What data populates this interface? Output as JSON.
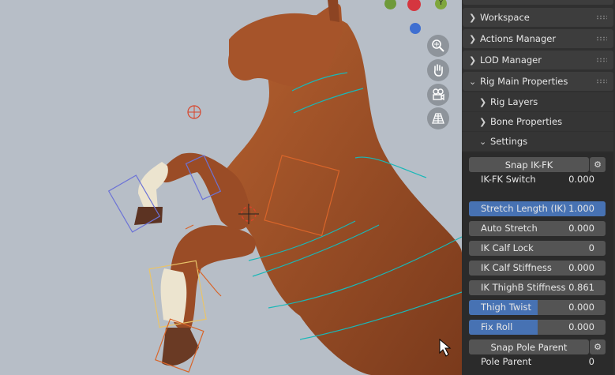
{
  "panel": {
    "sections": [
      {
        "label": "Workspace",
        "chevron": "right"
      },
      {
        "label": "Actions Manager",
        "chevron": "right"
      },
      {
        "label": "LOD Manager",
        "chevron": "right"
      },
      {
        "label": "Rig Main Properties",
        "chevron": "down"
      }
    ],
    "subsections": [
      {
        "label": "Rig Layers",
        "chevron": "right"
      },
      {
        "label": "Bone Properties",
        "chevron": "right"
      },
      {
        "label": "Settings",
        "chevron": "down"
      }
    ],
    "snap_ikfk": "Snap IK-FK",
    "ikfk_switch": {
      "label": "IK-FK Switch",
      "value": "0.000"
    },
    "stretch_length": {
      "label": "Stretch Length (IK)",
      "value": "1.000",
      "fill": 1.0
    },
    "auto_stretch": {
      "label": "Auto Stretch",
      "value": "0.000"
    },
    "ik_calf_lock": {
      "label": "IK Calf Lock",
      "value": "0"
    },
    "ik_calf_stiffness": {
      "label": "IK Calf Stiffness",
      "value": "0.000"
    },
    "ik_thighb_stiffness": {
      "label": "IK ThighB Stiffness",
      "value": "0.861"
    },
    "thigh_twist": {
      "label": "Thigh Twist",
      "value": "0.000",
      "fill": 0.5
    },
    "fix_roll": {
      "label": "Fix Roll",
      "value": "0.000",
      "fill": 0.5
    },
    "snap_pole_parent": "Snap Pole Parent",
    "pole_parent": {
      "label": "Pole Parent",
      "value": "0"
    }
  },
  "viewport": {
    "nav_icons": [
      "zoom-icon",
      "pan-hand-icon",
      "camera-icon",
      "grid-perspective-icon"
    ],
    "gizmo_labels": {
      "y": "Y"
    },
    "colors": {
      "background": "#b7bec7",
      "horse": "#a0512a",
      "panel": "#303030",
      "slider_fill": "#4772b3"
    }
  }
}
